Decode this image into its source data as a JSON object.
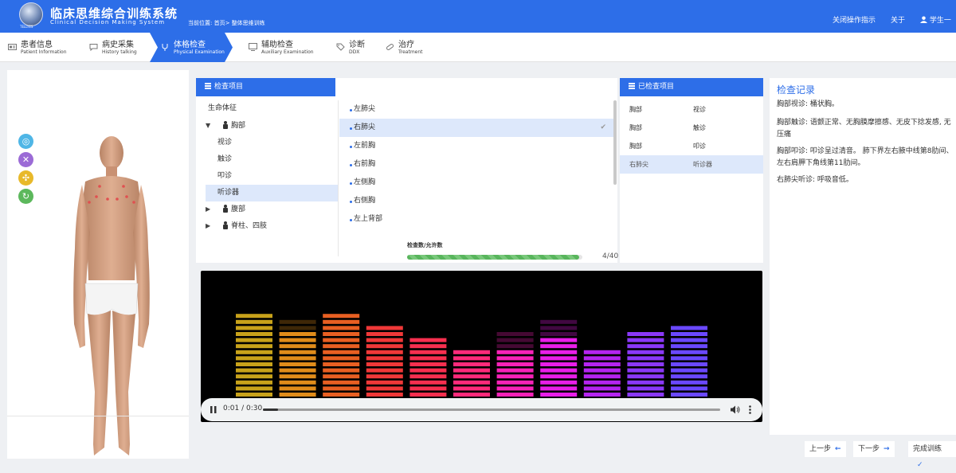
{
  "header": {
    "logo_text": "TELLYES",
    "title": "临床思维综合训练系统",
    "subtitle": "Clinical Decision Making System",
    "breadcrumb": "当前位置: 首页> 整体思维训练",
    "close_guide": "关闭操作指示",
    "about": "关于",
    "user": "学生一",
    "color": "#2d6ee8"
  },
  "tabs": [
    {
      "label": "患者信息",
      "sub": "Patient Information",
      "icon": "id-card-icon"
    },
    {
      "label": "病史采集",
      "sub": "History talking",
      "icon": "chat-icon"
    },
    {
      "label": "体格检查",
      "sub": "Physical Examination",
      "icon": "stethoscope-icon",
      "active": true
    },
    {
      "label": "辅助检查",
      "sub": "Auxiliary Examination",
      "icon": "monitor-icon"
    },
    {
      "label": "诊断",
      "sub": "DDX",
      "icon": "tag-icon"
    },
    {
      "label": "治疗",
      "sub": "Treatment",
      "icon": "pill-icon"
    }
  ],
  "tools": [
    "target-icon",
    "collapse-icon",
    "expand-icon",
    "refresh-icon"
  ],
  "exam": {
    "title": "检查项目",
    "tree": {
      "vitals": "生命体征",
      "chest": "胸部",
      "chest_items": [
        "视诊",
        "触诊",
        "叩诊",
        "听诊器"
      ],
      "abdomen": "腹部",
      "spine": "脊柱、四肢"
    },
    "sites": [
      "左肺尖",
      "右肺尖",
      "左前胸",
      "右前胸",
      "左侧胸",
      "右侧胸",
      "左上背部"
    ],
    "selected_site": "右肺尖",
    "progress_label": "检查数/允许数",
    "progress_done": 4,
    "progress_total": 40,
    "progress_text": "4/40"
  },
  "checked": {
    "title": "已检查项目",
    "rows": [
      [
        "胸部",
        "视诊"
      ],
      [
        "胸部",
        "触诊"
      ],
      [
        "胸部",
        "叩诊"
      ],
      [
        "右肺尖",
        "听诊器"
      ]
    ]
  },
  "record": {
    "title": "检查记录",
    "lines": [
      "胸部视诊: 桶状胸。",
      "胸部触诊: 语颤正常、无胸膜摩擦感、无皮下捻发感, 无压痛",
      "胸部叩诊: 叩诊呈过清音。 肺下界左右腋中线第8肋间、左右肩胛下角线第11肋间。",
      "右肺尖听诊: 呼吸音低。"
    ]
  },
  "audio": {
    "time": "0:01 / 0:30",
    "progress": 0.033,
    "bars": [
      {
        "level": 0.83,
        "faded": 0,
        "color": "#c8a21a"
      },
      {
        "level": 0.67,
        "faded": 0.77,
        "color": "#e08c1a"
      },
      {
        "level": 0.83,
        "faded": 0,
        "color": "#e85f22"
      },
      {
        "level": 0.72,
        "faded": 0,
        "color": "#f03838"
      },
      {
        "level": 0.61,
        "faded": 0,
        "color": "#f72f4f"
      },
      {
        "level": 0.5,
        "faded": 0,
        "color": "#ff2a7a"
      },
      {
        "level": 0.5,
        "faded": 0.66,
        "color": "#f722b8"
      },
      {
        "level": 0.61,
        "faded": 0.77,
        "color": "#e81ee8"
      },
      {
        "level": 0.45,
        "faded": 0,
        "color": "#b424f0"
      },
      {
        "level": 0.66,
        "faded": 0,
        "color": "#8a38f8"
      },
      {
        "level": 0.72,
        "faded": 0,
        "color": "#6a48ff"
      }
    ]
  },
  "nav": {
    "prev": "上一步",
    "next": "下一步",
    "finish": "完成训练"
  }
}
